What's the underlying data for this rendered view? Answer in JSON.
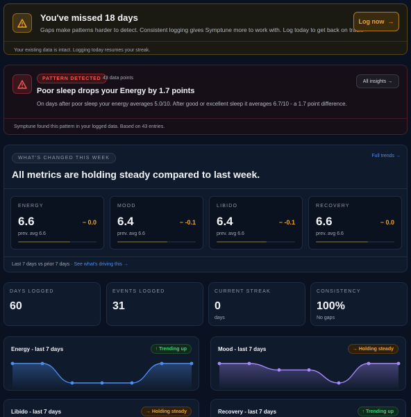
{
  "alert": {
    "title": "You've missed 18 days",
    "message": "Gaps make patterns harder to detect. Consistent logging gives Symptune more to work with. Log today to get back on track.",
    "button": "Log now",
    "footer": "Your existing data is intact. Logging today resumes your streak.",
    "icon": "warning-icon"
  },
  "pattern": {
    "badge": "PATTERN DETECTED",
    "points": "43 data points",
    "title": "Poor sleep drops your Energy by 1.7 points",
    "description": "On days after poor sleep your energy averages 5.0/10. After good or excellent sleep it averages 6.7/10 - a 1.7 point difference.",
    "button": "All insights →",
    "footer": "Symptune found this pattern in your logged data. Based on 43 entries.",
    "icon": "warning-icon"
  },
  "changes": {
    "kicker": "WHAT'S CHANGED THIS WEEK",
    "link": "Full trends →",
    "headline": "All metrics are holding steady compared to last week.",
    "footer_text": "Last 7 days vs prior 7 days · ",
    "footer_link": "See what's driving this →",
    "metrics": [
      {
        "label": "ENERGY",
        "value": "6.6",
        "delta": "− 0.0",
        "prev": "prev. avg 6.6",
        "level": 0.66
      },
      {
        "label": "MOOD",
        "value": "6.4",
        "delta": "− -0.1",
        "prev": "prev. avg 6.6",
        "level": 0.64
      },
      {
        "label": "LIBIDO",
        "value": "6.4",
        "delta": "− -0.1",
        "prev": "prev. avg 6.6",
        "level": 0.64
      },
      {
        "label": "RECOVERY",
        "value": "6.6",
        "delta": "− 0.0",
        "prev": "prev. avg 6.6",
        "level": 0.66
      }
    ],
    "colors": {
      "delta": "#f1a62a",
      "link": "#4d8ef0"
    }
  },
  "stats": [
    {
      "label": "DAYS LOGGED",
      "value": "60",
      "sub": ""
    },
    {
      "label": "EVENTS LOGGED",
      "value": "31",
      "sub": ""
    },
    {
      "label": "CURRENT STREAK",
      "value": "0",
      "sub": "days"
    },
    {
      "label": "CONSISTENCY",
      "value": "100%",
      "sub": "No gaps"
    }
  ],
  "trends": [
    {
      "title": "Energy - last 7 days",
      "badge": "↑ Trending up",
      "badge_kind": "up",
      "color": "#4d8ef0",
      "values": [
        8,
        8,
        5,
        5,
        5,
        8,
        8
      ]
    },
    {
      "title": "Mood - last 7 days",
      "badge": "→ Holding steady",
      "badge_kind": "steady",
      "color": "#a78bfa",
      "values": [
        8,
        8,
        7,
        7,
        5,
        8,
        8
      ]
    },
    {
      "title": "Libido - last 7 days",
      "badge": "→ Holding steady",
      "badge_kind": "steady",
      "color": "#a78bfa",
      "values": []
    },
    {
      "title": "Recovery - last 7 days",
      "badge": "↑ Trending up",
      "badge_kind": "up",
      "color": "#3fd07a",
      "values": []
    }
  ]
}
